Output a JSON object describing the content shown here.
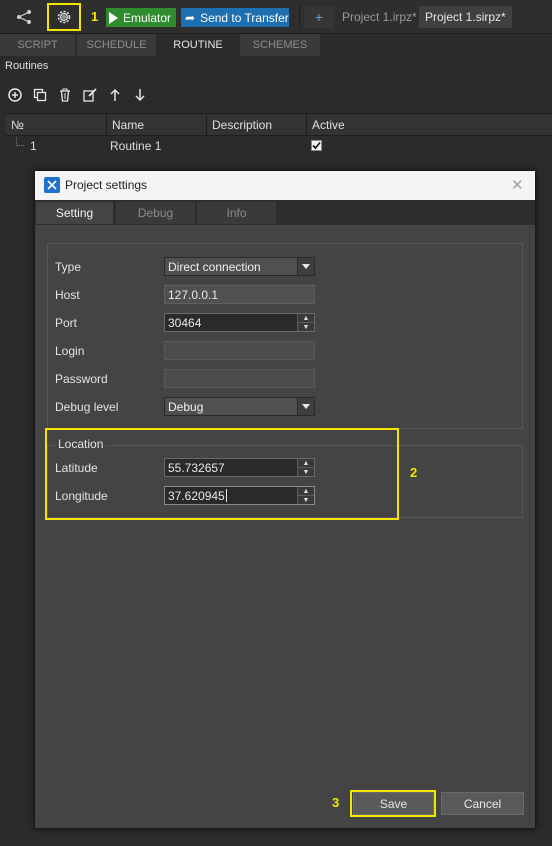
{
  "toolbar": {
    "emulator_label": "Emulator",
    "send_label": "Send to Transfer",
    "add_tab": "+",
    "doc_tabs": [
      "Project 1.irpz*",
      "Project 1.sirpz*"
    ],
    "markers": [
      "1",
      "2",
      "3"
    ]
  },
  "main_tabs": [
    "SCRIPT",
    "SCHEDULE",
    "ROUTINE",
    "SCHEMES"
  ],
  "active_main_tab": "ROUTINE",
  "routines": {
    "title": "Routines",
    "icons": [
      "add-icon",
      "copy-icon",
      "delete-icon",
      "edit-icon",
      "move-up-icon",
      "move-down-icon"
    ],
    "columns": [
      "№",
      "Name",
      "Description",
      "Active"
    ],
    "rows": [
      {
        "num": "1",
        "name": "Routine 1",
        "description": "",
        "active": true
      }
    ]
  },
  "dialog": {
    "title": "Project settings",
    "tabs": [
      "Setting",
      "Debug",
      "Info"
    ],
    "active_tab": "Setting",
    "fields": {
      "type_label": "Type",
      "type_value": "Direct connection",
      "host_label": "Host",
      "host_value": "127.0.0.1",
      "port_label": "Port",
      "port_value": "30464",
      "login_label": "Login",
      "login_value": "",
      "password_label": "Password",
      "password_value": "",
      "debug_label": "Debug level",
      "debug_value": "Debug"
    },
    "location": {
      "title": "Location",
      "latitude_label": "Latitude",
      "latitude_value": "55.732657",
      "longitude_label": "Longitude",
      "longitude_value": "37.620945"
    },
    "save_label": "Save",
    "cancel_label": "Cancel"
  },
  "colors": {
    "highlight": "#f5e600",
    "emulator": "#2e8b2e",
    "send": "#1e6fb0",
    "dialog_bg": "#444444"
  }
}
